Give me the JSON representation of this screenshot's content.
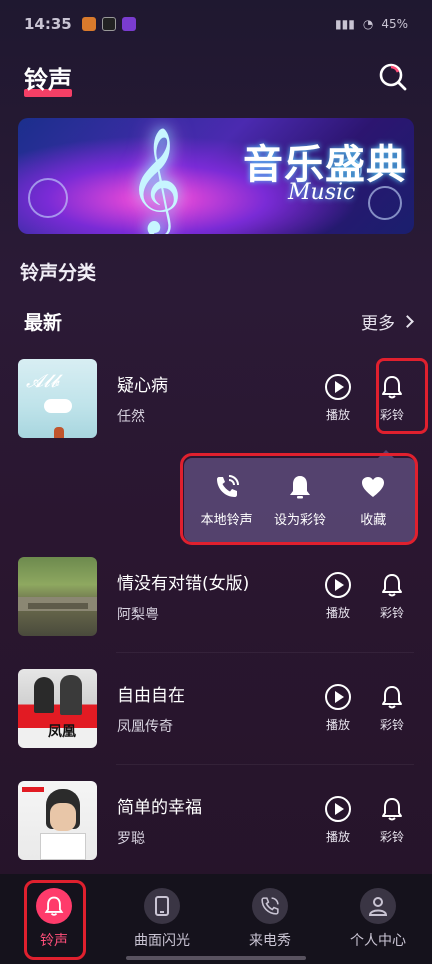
{
  "status": {
    "time": "14:35",
    "battery": "45%"
  },
  "header": {
    "title": "铃声"
  },
  "banner": {
    "title": "音乐盛典",
    "subtitle": "Music"
  },
  "category": {
    "title": "铃声分类"
  },
  "latest": {
    "label": "最新",
    "more": "更多"
  },
  "actions": {
    "play": "播放",
    "ringback": "彩铃"
  },
  "songs": [
    {
      "name": "疑心病",
      "artist": "任然"
    },
    {
      "name": "情没有对错(女版)",
      "artist": "阿梨粤"
    },
    {
      "name": "自由自在",
      "artist": "凤凰传奇"
    },
    {
      "name": "简单的幸福",
      "artist": "罗聪"
    }
  ],
  "popup": {
    "local": "本地铃声",
    "set_ringback": "设为彩铃",
    "favorite": "收藏"
  },
  "tabs": [
    {
      "label": "铃声"
    },
    {
      "label": "曲面闪光"
    },
    {
      "label": "来电秀"
    },
    {
      "label": "个人中心"
    }
  ],
  "colors": {
    "accent": "#ff3b6b",
    "highlight": "#e0202e"
  }
}
